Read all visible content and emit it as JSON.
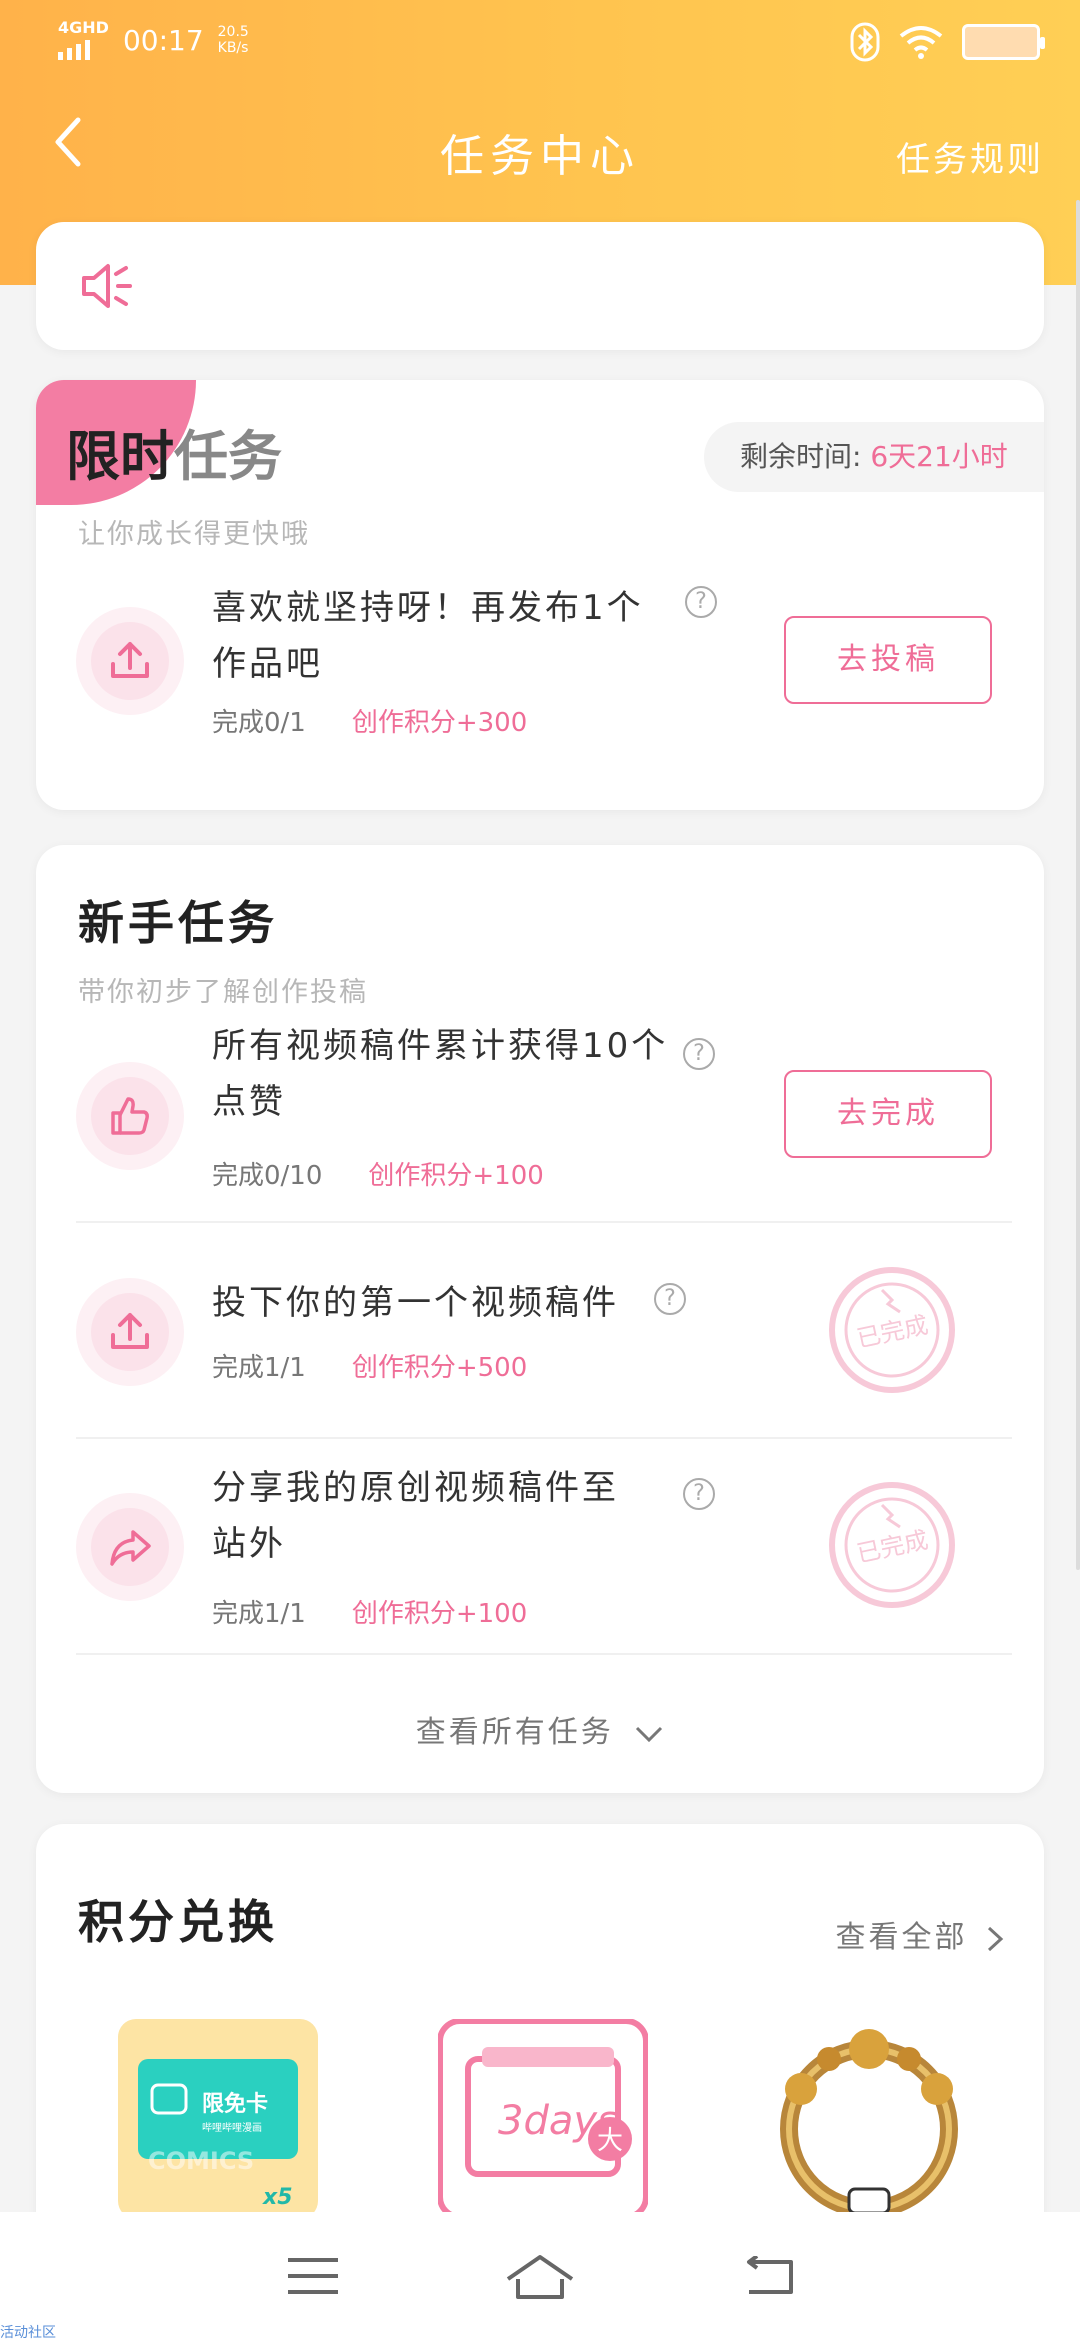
{
  "status_bar": {
    "network": "4GHD",
    "time": "00:17",
    "speed_value": "20.5",
    "speed_unit": "KB/s"
  },
  "header": {
    "title": "任务中心",
    "rules_label": "任务规则"
  },
  "limited": {
    "title_a": "限时",
    "title_b": "任务",
    "remaining_label": "剩余时间: ",
    "remaining_value": "6天21小时",
    "subtitle": "让你成长得更快哦",
    "task": {
      "line1": "喜欢就坚持呀！再发布1个",
      "line2": "作品吧",
      "progress": "完成0/1",
      "points": "创作积分+300",
      "button": "去投稿",
      "icon": "upload-icon"
    }
  },
  "novice": {
    "title": "新手任务",
    "subtitle": "带你初步了解创作投稿",
    "tasks": [
      {
        "line1": "所有视频稿件累计获得10个",
        "line2": "点赞",
        "progress": "完成0/10",
        "points": "创作积分+100",
        "button": "去完成",
        "icon": "thumbs-up-icon"
      },
      {
        "line1": "投下你的第一个视频稿件",
        "line2": "",
        "progress": "完成1/1",
        "points": "创作积分+500",
        "stamp": "已完成",
        "icon": "upload-icon"
      },
      {
        "line1": "分享我的原创视频稿件至",
        "line2": "站外",
        "progress": "完成1/1",
        "points": "创作积分+100",
        "stamp": "已完成",
        "icon": "share-icon"
      }
    ],
    "see_all": "查看所有任务"
  },
  "exchange": {
    "title": "积分兑换",
    "see_all": "查看全部",
    "prizes": [
      {
        "name": "comics-card",
        "card_label": "限免卡",
        "small_text": "哔哩哔哩漫画",
        "badge": "COMICS",
        "count": "x5"
      },
      {
        "name": "3days-card",
        "label": "3days",
        "badge": "大"
      },
      {
        "name": "avatar-frame"
      }
    ]
  },
  "footer": {
    "watermark": "活动社区"
  },
  "colors": {
    "accent_pink": "#ef6d97",
    "header_orange": "#ffb24a",
    "header_yellow": "#ffcf55"
  }
}
